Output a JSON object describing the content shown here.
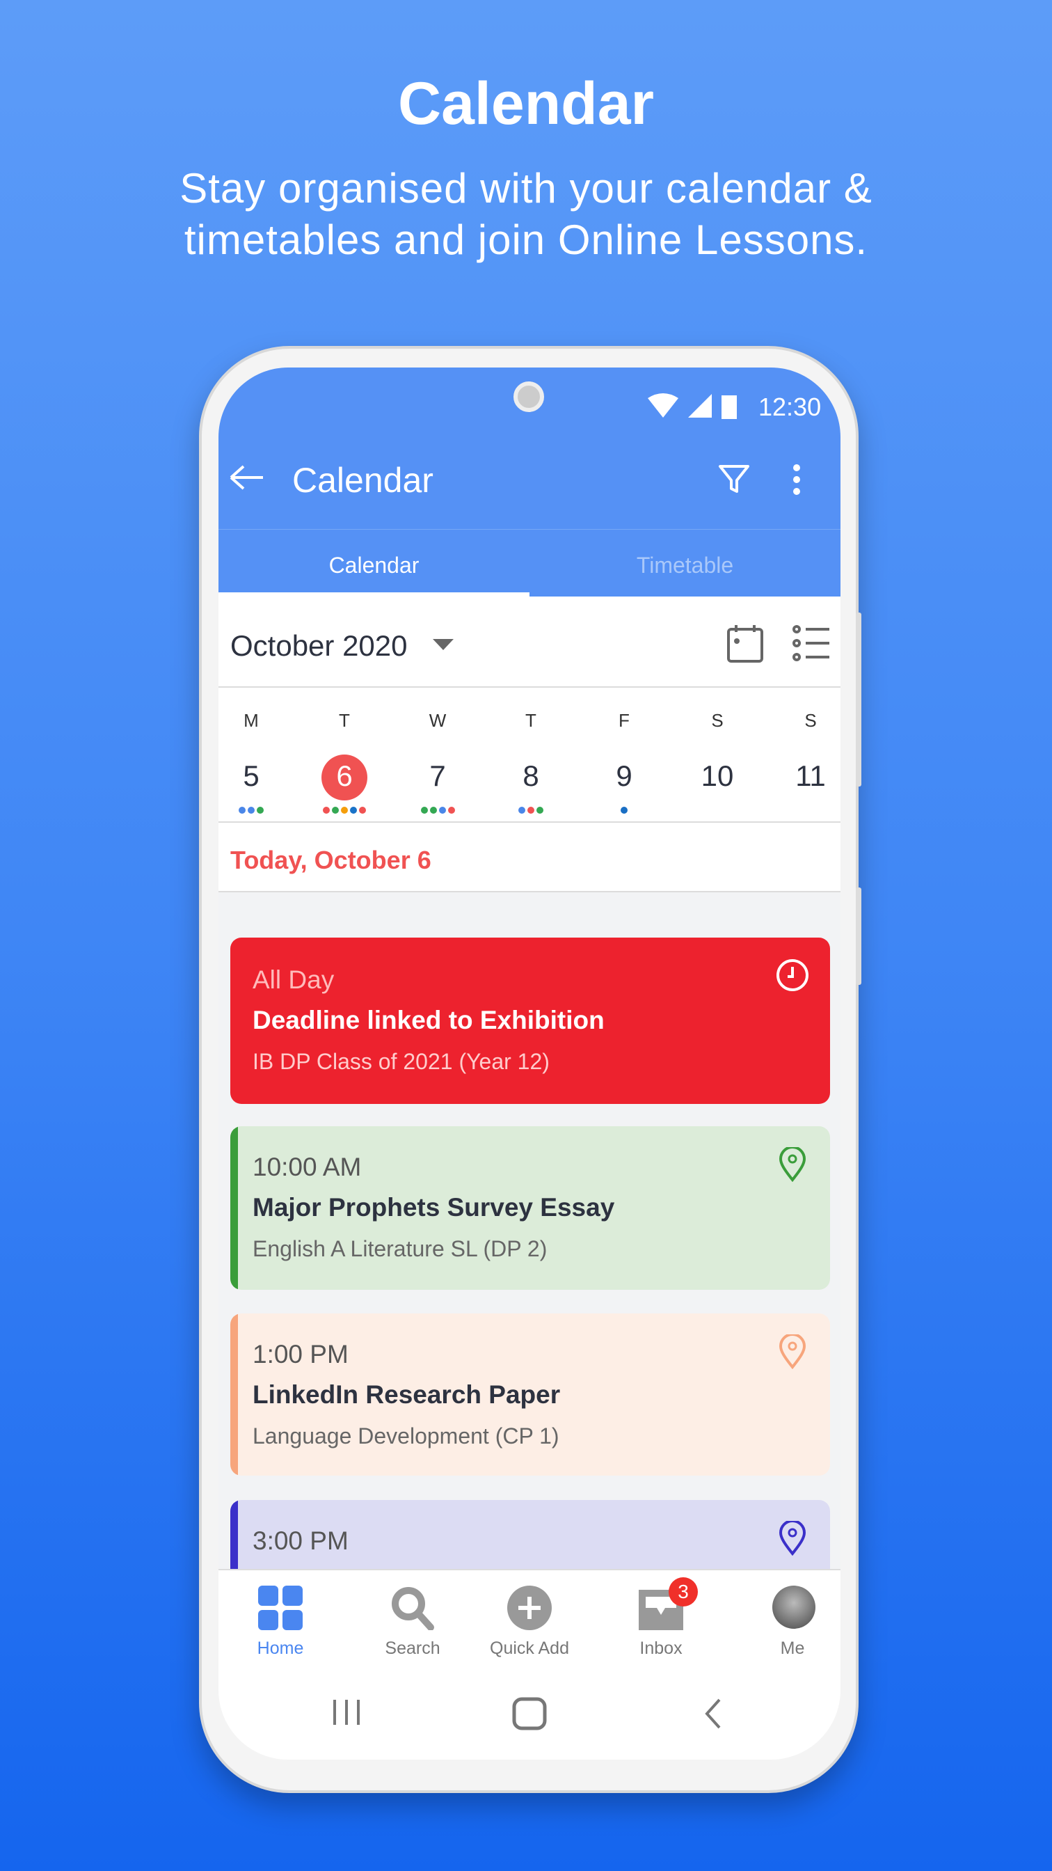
{
  "hero": {
    "title": "Calendar",
    "subtitle_line1": "Stay organised with your calendar &",
    "subtitle_line2": "timetables and join Online Lessons."
  },
  "status": {
    "time": "12:30"
  },
  "appbar": {
    "title": "Calendar"
  },
  "tabs": [
    {
      "label": "Calendar",
      "active": true
    },
    {
      "label": "Timetable",
      "active": false
    }
  ],
  "month": {
    "label": "October 2020"
  },
  "week": [
    {
      "letter": "M",
      "date": "5",
      "dots": [
        "#4a86e8",
        "#4a86e8",
        "#34a853"
      ]
    },
    {
      "letter": "T",
      "date": "6",
      "today": true,
      "dots": [
        "#f05252",
        "#34a853",
        "#f59e0b",
        "#1a73c8",
        "#f05252"
      ]
    },
    {
      "letter": "W",
      "date": "7",
      "dots": [
        "#34a853",
        "#34a853",
        "#4a86e8",
        "#f05252"
      ]
    },
    {
      "letter": "T",
      "date": "8",
      "dots": [
        "#4a86e8",
        "#f05252",
        "#34a853"
      ]
    },
    {
      "letter": "F",
      "date": "9",
      "dots": [
        "#1a6fc4"
      ]
    },
    {
      "letter": "S",
      "date": "10",
      "dots": []
    },
    {
      "letter": "S",
      "date": "11",
      "dots": []
    }
  ],
  "today_label": "Today, October 6",
  "events": [
    {
      "time": "All Day",
      "title": "Deadline linked to Exhibition",
      "subtitle": "IB DP Class of 2021 (Year 12)",
      "icon": "clock-icon",
      "bg": "#ed222e",
      "accent": "#ed222e"
    },
    {
      "time": "10:00 AM",
      "title": "Major Prophets Survey Essay",
      "subtitle": "English A Literature SL (DP 2)",
      "icon": "location-pin-icon",
      "bg": "#dcecd9",
      "accent": "#3a9d3a"
    },
    {
      "time": "1:00 PM",
      "title": "LinkedIn Research Paper",
      "subtitle": "Language Development (CP 1)",
      "icon": "location-pin-icon",
      "bg": "#fdeee5",
      "accent": "#f7a57c"
    },
    {
      "time": "3:00 PM",
      "title": "",
      "subtitle": "",
      "icon": "location-pin-icon",
      "bg": "#dcdcf3",
      "accent": "#3b30c9"
    }
  ],
  "bottom_nav": [
    {
      "label": "Home",
      "active": true
    },
    {
      "label": "Search"
    },
    {
      "label": "Quick Add"
    },
    {
      "label": "Inbox",
      "badge": "3"
    },
    {
      "label": "Me"
    }
  ],
  "colors": {
    "primary": "#5591f5",
    "today": "#f05252"
  }
}
